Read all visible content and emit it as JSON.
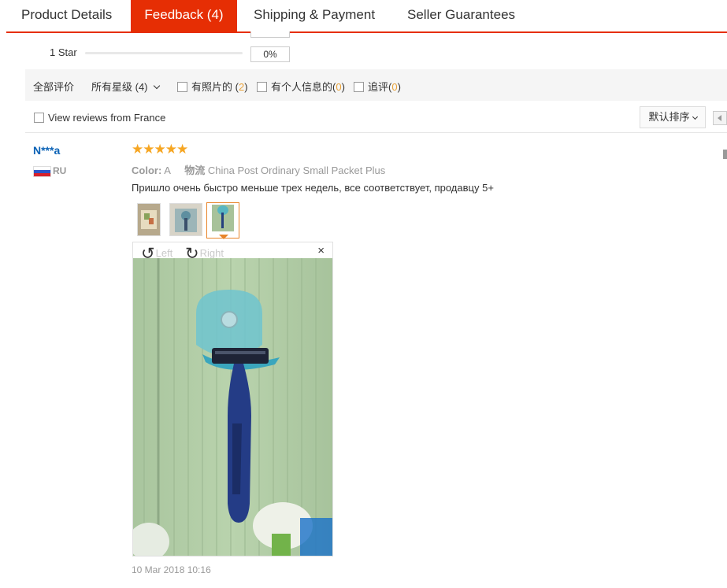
{
  "tabs": [
    {
      "label": "Product Details"
    },
    {
      "label": "Feedback (4)"
    },
    {
      "label": "Shipping & Payment"
    },
    {
      "label": "Seller Guarantees"
    }
  ],
  "rating_rows": [
    {
      "label": "1 Star",
      "percent_text": "0%",
      "fill_fraction": 0
    }
  ],
  "filters": {
    "all": "全部评价",
    "stars_select": "所有星级 (4)",
    "photo_label": "有照片的 (",
    "photo_count": "2",
    "personal_label": "有个人信息的(",
    "personal_count": "0",
    "followup_label": "追评(",
    "followup_count": "0",
    "close_paren": ")"
  },
  "country_filter": {
    "label": "View reviews from France"
  },
  "sort": {
    "label": "默认排序"
  },
  "review": {
    "user": "N***a",
    "country": "RU",
    "stars": "★★★★★",
    "rating": 5,
    "color_label": "Color:",
    "color_value": "A",
    "logistics_label": "物流",
    "logistics_value": "China Post Ordinary Small Packet Plus",
    "text": "Пришло очень быстро меньше трех недель, все соответствует, продавцу 5+",
    "viewer": {
      "left_label": "Left",
      "right_label": "Right",
      "rotate_left_icon": "rotate-left-icon",
      "rotate_right_icon": "rotate-right-icon",
      "close_icon": "close-icon",
      "close_glyph": "×"
    },
    "date": "10 Mar 2018 10:16"
  },
  "colors": {
    "accent": "#e62e04",
    "user_link": "#0c63b6",
    "star": "#f6a623",
    "count": "#e8a23a"
  }
}
